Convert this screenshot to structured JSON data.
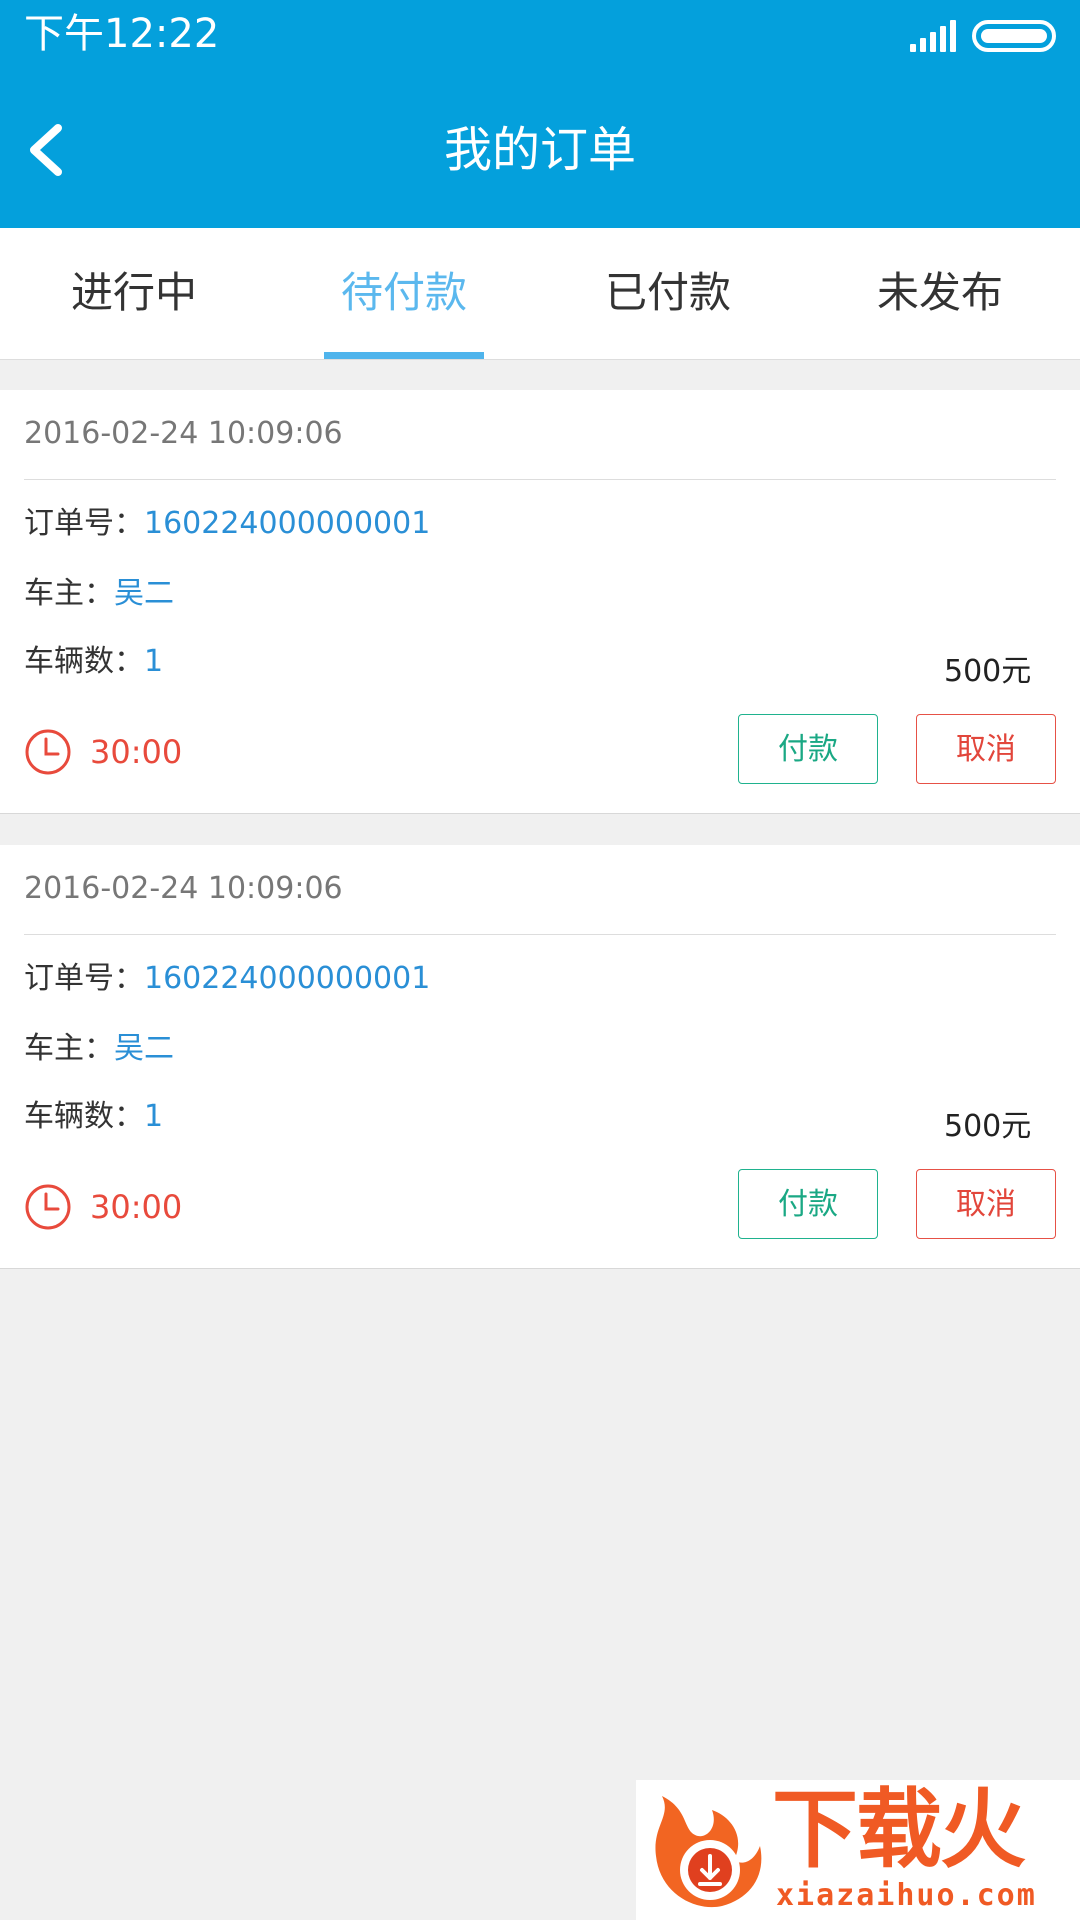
{
  "status_bar": {
    "time": "下午12:22"
  },
  "header": {
    "title": "我的订单"
  },
  "tabs": [
    {
      "label": "进行中",
      "active": false
    },
    {
      "label": "待付款",
      "active": true
    },
    {
      "label": "已付款",
      "active": false
    },
    {
      "label": "未发布",
      "active": false
    }
  ],
  "orders": [
    {
      "datetime": "2016-02-24  10:09:06",
      "order_no_label": "订单号：",
      "order_no": "160224000000001",
      "owner_label": "车主：",
      "owner": "吴二",
      "vehicles_label": "车辆数：",
      "vehicles": "1",
      "price": "500元",
      "countdown": "30:00",
      "pay_label": "付款",
      "cancel_label": "取消"
    },
    {
      "datetime": "2016-02-24  10:09:06",
      "order_no_label": "订单号：",
      "order_no": "160224000000001",
      "owner_label": "车主：",
      "owner": "吴二",
      "vehicles_label": "车辆数：",
      "vehicles": "1",
      "price": "500元",
      "countdown": "30:00",
      "pay_label": "付款",
      "cancel_label": "取消"
    }
  ],
  "watermark": {
    "name": "下载火",
    "url": "xiazaihuo.com"
  },
  "colors": {
    "header_bg": "#04a0dc",
    "tab_active": "#5bb8ee",
    "value_blue": "#2a8fd6",
    "pay_green": "#1aa884",
    "alert_red": "#e2463b"
  }
}
